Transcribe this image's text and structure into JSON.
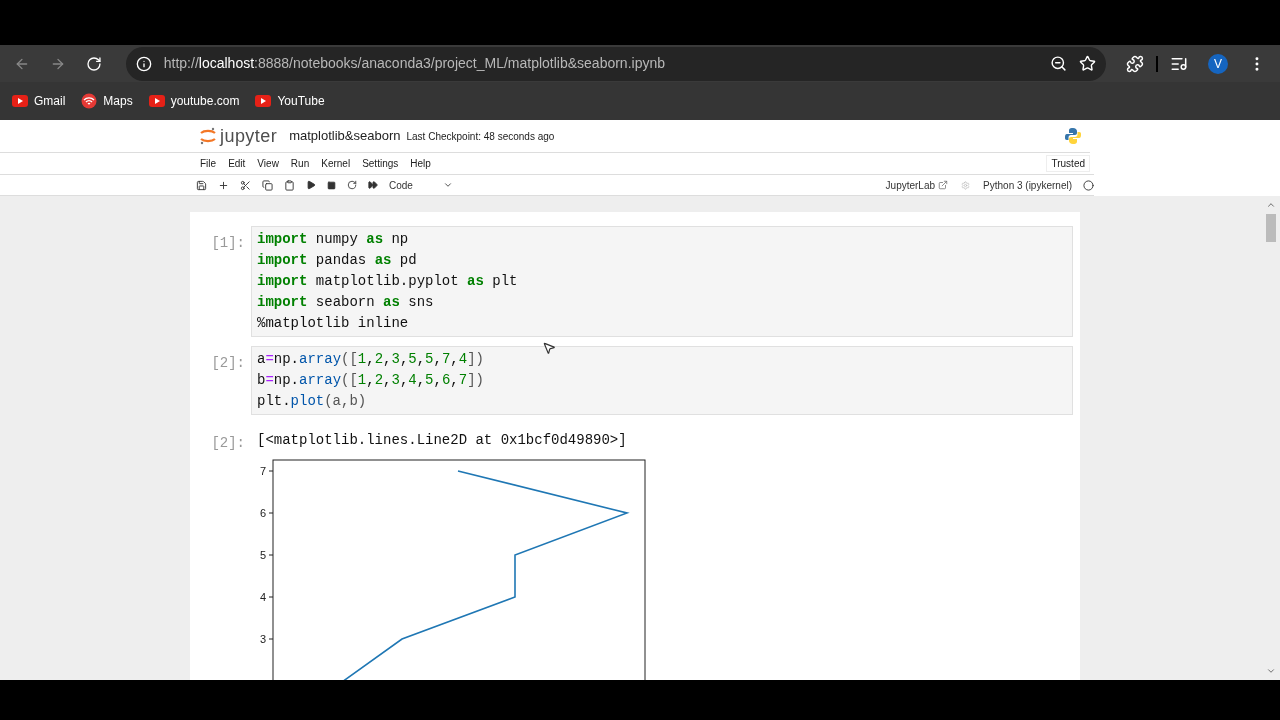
{
  "browser": {
    "url": {
      "scheme": "http://",
      "host": "localhost",
      "path": ":8888/notebooks/anaconda3/project_ML/matplotlib&seaborn.ipynb"
    },
    "avatar": "V",
    "bookmarks": [
      {
        "label": "Gmail",
        "kind": "play"
      },
      {
        "label": "Maps",
        "kind": "maps"
      },
      {
        "label": "youtube.com",
        "kind": "play"
      },
      {
        "label": "YouTube",
        "kind": "play"
      }
    ]
  },
  "jupyter": {
    "logo_text": "jupyter",
    "notebook_title": "matplotlib&seaborn",
    "checkpoint": "Last Checkpoint: 48 seconds ago",
    "menu": [
      "File",
      "Edit",
      "View",
      "Run",
      "Kernel",
      "Settings",
      "Help"
    ],
    "trusted": "Trusted",
    "cell_type": "Code",
    "lab_link": "JupyterLab",
    "kernel": "Python 3 (ipykernel)",
    "kernel_busy": false
  },
  "cells": [
    {
      "prompt": "[1]:",
      "lines": [
        [
          {
            "text": "import",
            "kind": "kw"
          },
          {
            "text": " numpy ",
            "kind": "text"
          },
          {
            "text": "as",
            "kind": "kw"
          },
          {
            "text": " np",
            "kind": "text"
          }
        ],
        [
          {
            "text": "import",
            "kind": "kw"
          },
          {
            "text": " pandas ",
            "kind": "text"
          },
          {
            "text": "as",
            "kind": "kw"
          },
          {
            "text": " pd",
            "kind": "text"
          }
        ],
        [
          {
            "text": "import",
            "kind": "kw"
          },
          {
            "text": " matplotlib.pyplot ",
            "kind": "text"
          },
          {
            "text": "as",
            "kind": "kw"
          },
          {
            "text": " plt",
            "kind": "text"
          }
        ],
        [
          {
            "text": "import",
            "kind": "kw"
          },
          {
            "text": " seaborn ",
            "kind": "text"
          },
          {
            "text": "as",
            "kind": "kw"
          },
          {
            "text": " sns",
            "kind": "text"
          }
        ],
        [
          {
            "text": "%matplotlib inline",
            "kind": "text"
          }
        ]
      ]
    },
    {
      "prompt": "[2]:",
      "lines": [
        [
          {
            "text": "a",
            "kind": "text"
          },
          {
            "text": "=",
            "kind": "op"
          },
          {
            "text": "np.",
            "kind": "text"
          },
          {
            "text": "array",
            "kind": "attr"
          },
          {
            "text": "([",
            "kind": "punct"
          },
          {
            "text": "1",
            "kind": "num"
          },
          {
            "text": ",",
            "kind": "text"
          },
          {
            "text": "2",
            "kind": "num"
          },
          {
            "text": ",",
            "kind": "text"
          },
          {
            "text": "3",
            "kind": "num"
          },
          {
            "text": ",",
            "kind": "text"
          },
          {
            "text": "5",
            "kind": "num"
          },
          {
            "text": ",",
            "kind": "text"
          },
          {
            "text": "5",
            "kind": "num"
          },
          {
            "text": ",",
            "kind": "text"
          },
          {
            "text": "7",
            "kind": "num"
          },
          {
            "text": ",",
            "kind": "text"
          },
          {
            "text": "4",
            "kind": "num"
          },
          {
            "text": "])",
            "kind": "punct"
          }
        ],
        [
          {
            "text": "b",
            "kind": "text"
          },
          {
            "text": "=",
            "kind": "op"
          },
          {
            "text": "np.",
            "kind": "text"
          },
          {
            "text": "array",
            "kind": "attr"
          },
          {
            "text": "([",
            "kind": "punct"
          },
          {
            "text": "1",
            "kind": "num"
          },
          {
            "text": ",",
            "kind": "text"
          },
          {
            "text": "2",
            "kind": "num"
          },
          {
            "text": ",",
            "kind": "text"
          },
          {
            "text": "3",
            "kind": "num"
          },
          {
            "text": ",",
            "kind": "text"
          },
          {
            "text": "4",
            "kind": "num"
          },
          {
            "text": ",",
            "kind": "text"
          },
          {
            "text": "5",
            "kind": "num"
          },
          {
            "text": ",",
            "kind": "text"
          },
          {
            "text": "6",
            "kind": "num"
          },
          {
            "text": ",",
            "kind": "text"
          },
          {
            "text": "7",
            "kind": "num"
          },
          {
            "text": "])",
            "kind": "punct"
          }
        ],
        [
          {
            "text": "plt.",
            "kind": "text"
          },
          {
            "text": "plot",
            "kind": "attr"
          },
          {
            "text": "(a,b)",
            "kind": "punct"
          }
        ]
      ],
      "output": {
        "prompt": "[2]:",
        "text": "[<matplotlib.lines.Line2D at 0x1bcf0d49890>]",
        "plot": {
          "y_tick_labels": [
            "7",
            "6",
            "5",
            "4",
            "3"
          ]
        }
      }
    }
  ]
}
